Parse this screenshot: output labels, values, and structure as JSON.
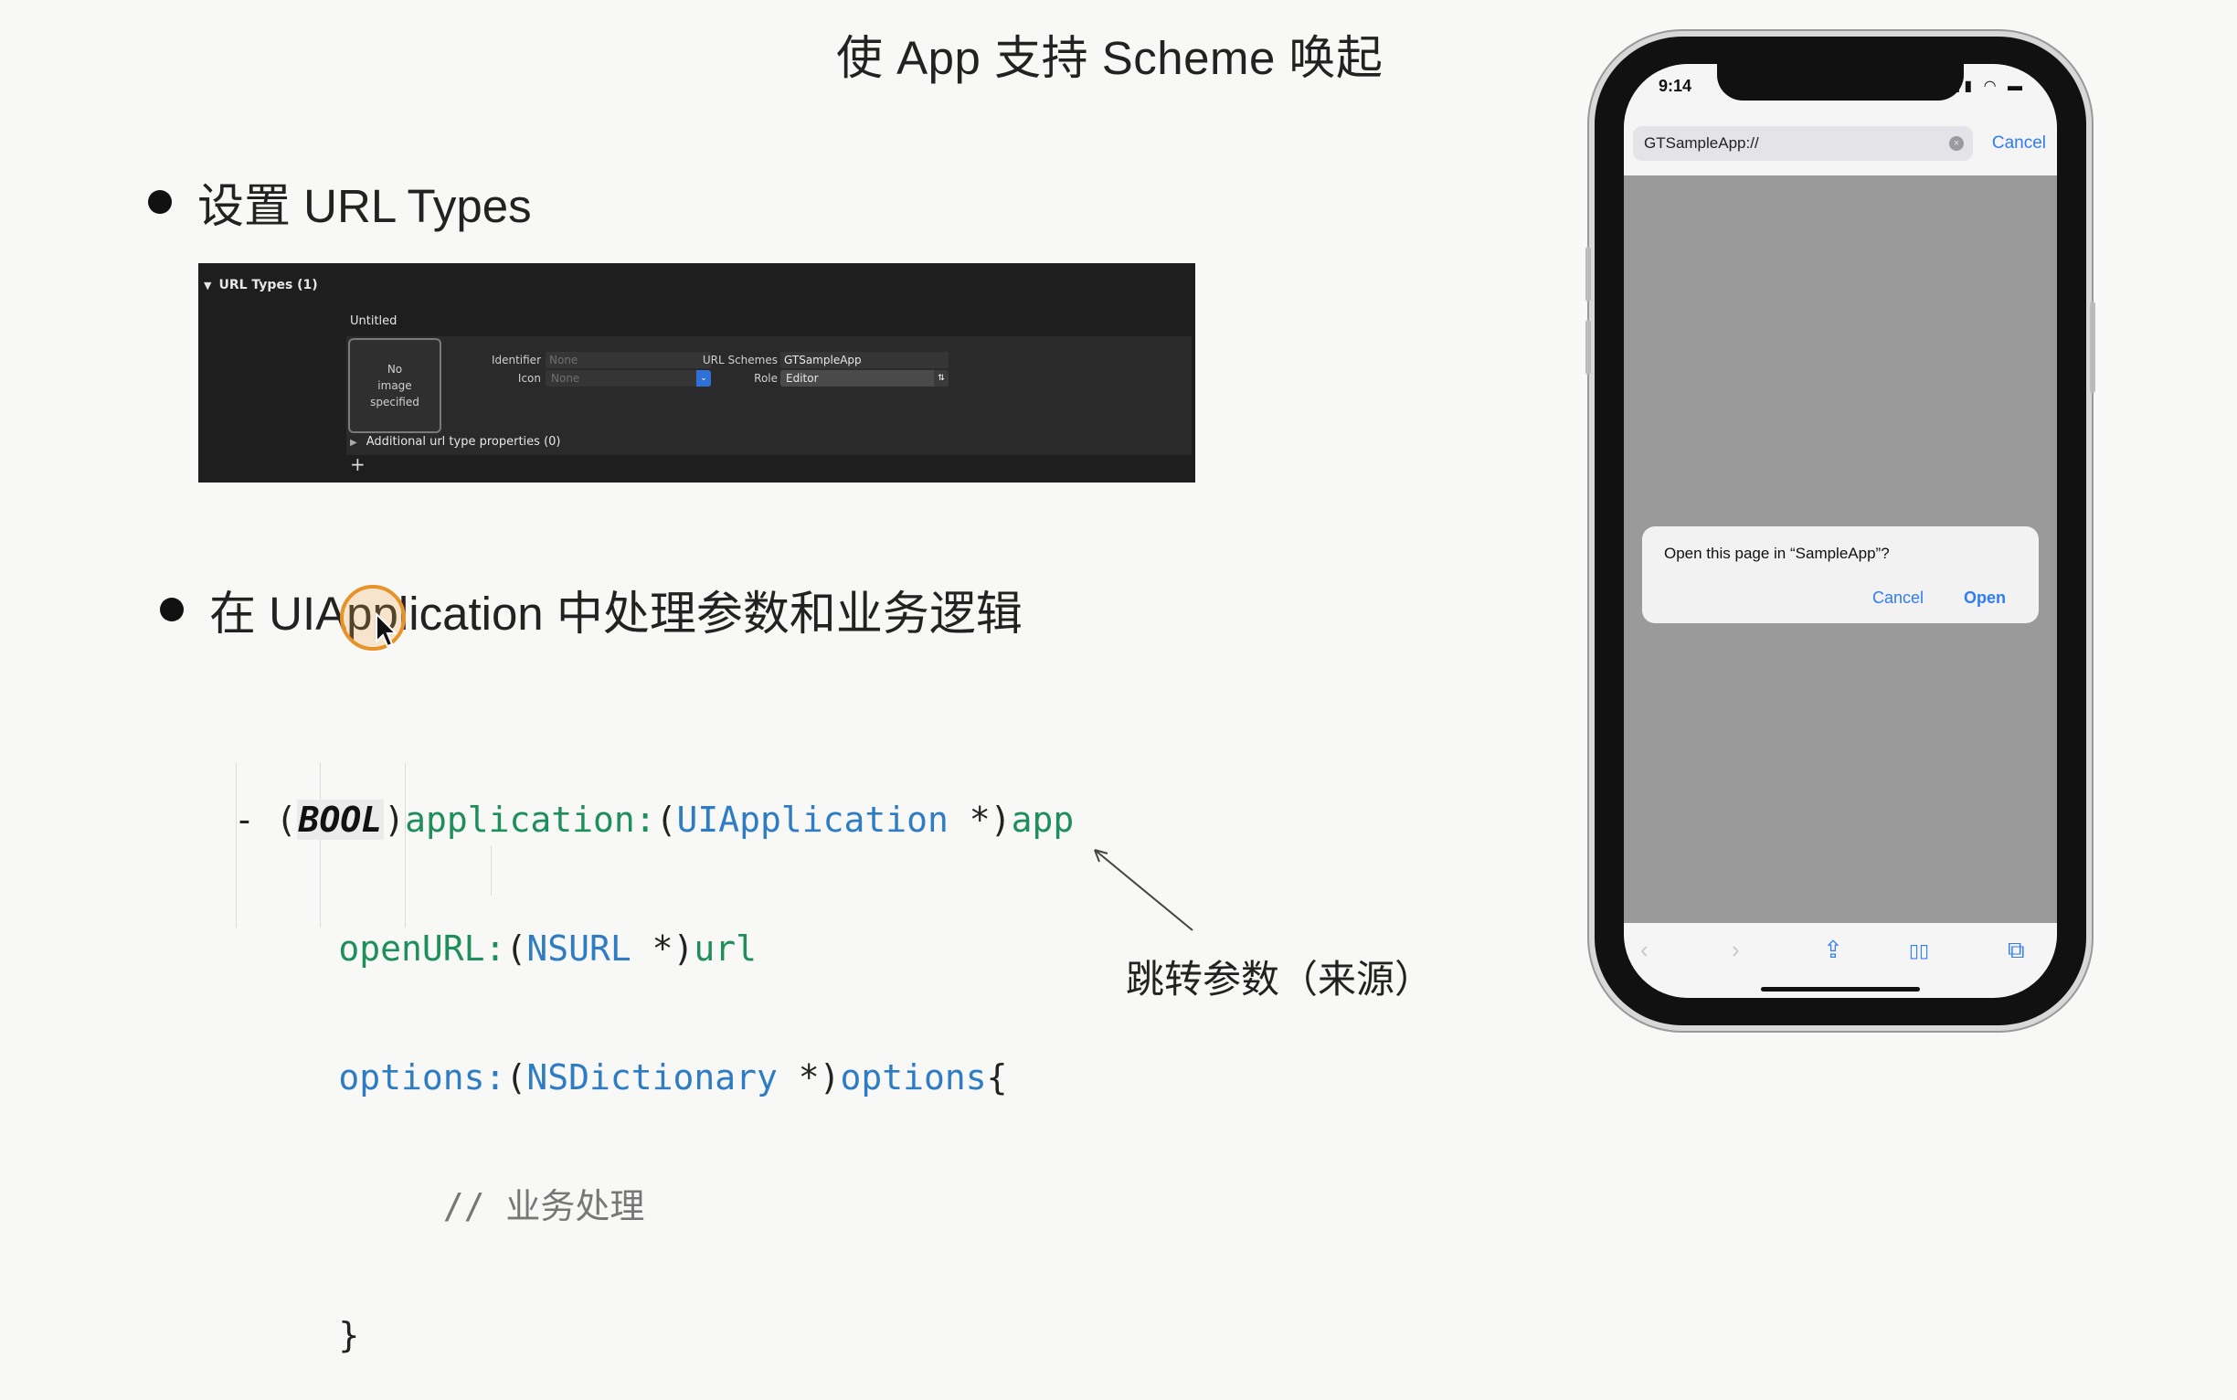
{
  "slide": {
    "title": "使 App 支持 Scheme 唤起",
    "bullet1": "设置 URL Types",
    "bullet2": "在 UIApplication 中处理参数和业务逻辑",
    "annotation": "跳转参数（来源）"
  },
  "xcode": {
    "section_header": "URL Types (1)",
    "item_name": "Untitled",
    "no_image_line1": "No",
    "no_image_line2": "image",
    "no_image_line3": "specified",
    "identifier_label": "Identifier",
    "identifier_placeholder": "None",
    "icon_label": "Icon",
    "icon_placeholder": "None",
    "url_schemes_label": "URL Schemes",
    "url_schemes_value": "GTSampleApp",
    "role_label": "Role",
    "role_value": "Editor",
    "additional_props": "Additional url type properties (0)",
    "add_symbol": "+"
  },
  "code": {
    "dash": "- ",
    "paren_open": "(",
    "bool": "BOOL",
    "paren_close": ")",
    "sel1": "application:",
    "t1_open": "(",
    "t1": "UIApplication",
    "t1_ptr": " *)",
    "p1": "app",
    "sel2": "openURL:",
    "t2_open": "(",
    "t2": "NSURL",
    "t2_ptr": " *)",
    "p2": "url",
    "sel3": "options:",
    "t3_open": "(",
    "t3": "NSDictionary",
    "t3_ptr": " *)",
    "p3": "options",
    "brace_open": "{",
    "comment": "// 业务处理",
    "brace_close": "}"
  },
  "phone": {
    "time": "9:14",
    "status_icons": "▮▮▮ ◠ ▬",
    "address_value": "GTSampleApp://",
    "address_cancel": "Cancel",
    "alert_message": "Open this page in “SampleApp”?",
    "alert_cancel": "Cancel",
    "alert_open": "Open",
    "toolbar": {
      "back": "‹",
      "forward": "›",
      "share": "⇪",
      "bookmarks": "▯▯",
      "tabs": "⧉"
    }
  }
}
